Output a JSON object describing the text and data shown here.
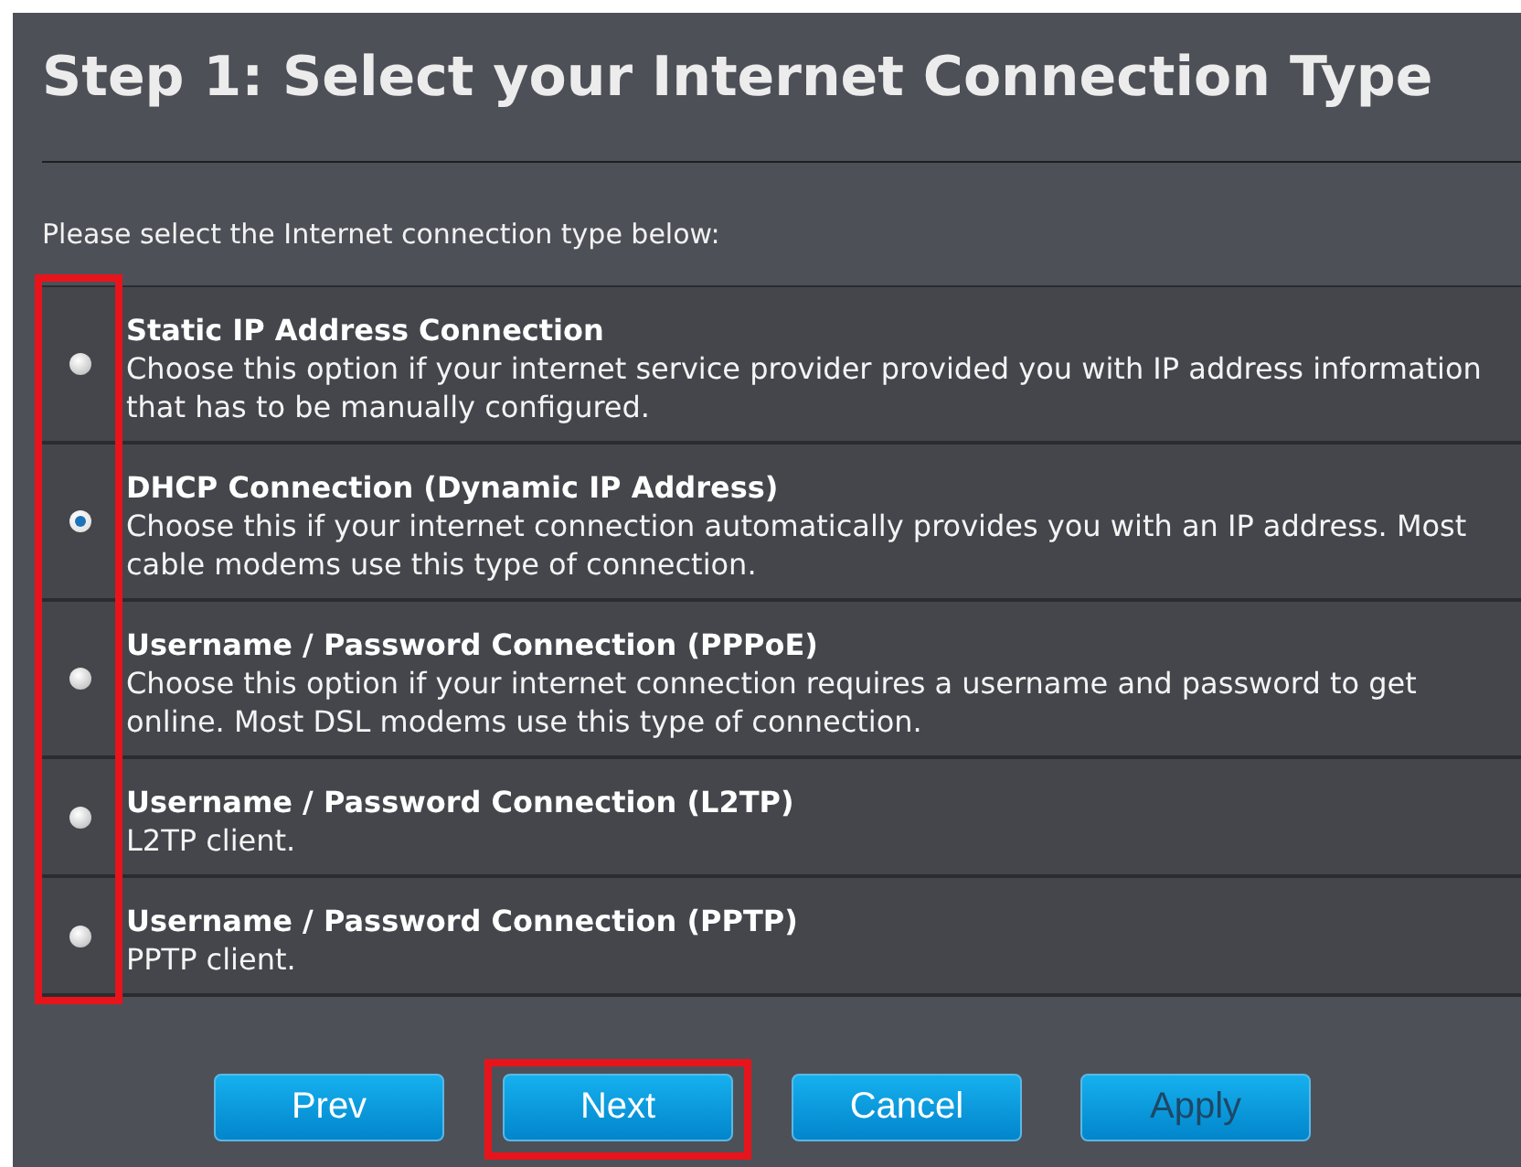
{
  "title": "Step 1: Select your Internet Connection Type",
  "prompt": "Please select the Internet connection type below:",
  "radio_column_highlighted": true,
  "options": [
    {
      "label": "Static IP Address Connection",
      "description": "Choose this option if your internet service provider provided you with IP address information that has to be manually configured.",
      "selected": false
    },
    {
      "label": "DHCP Connection (Dynamic IP Address)",
      "description": "Choose this if your internet connection automatically provides you with an IP address. Most cable modems use this type of connection.",
      "selected": true
    },
    {
      "label": "Username / Password Connection (PPPoE)",
      "description": "Choose this option if your internet connection requires a username and password to get online. Most DSL modems use this type of connection.",
      "selected": false
    },
    {
      "label": "Username / Password Connection (L2TP)",
      "description": "L2TP client.",
      "selected": false
    },
    {
      "label": "Username / Password Connection (PPTP)",
      "description": "PPTP client.",
      "selected": false
    }
  ],
  "buttons": [
    {
      "label": "Prev",
      "disabled": false,
      "highlighted": false
    },
    {
      "label": "Next",
      "disabled": false,
      "highlighted": true
    },
    {
      "label": "Cancel",
      "disabled": false,
      "highlighted": false
    },
    {
      "label": "Apply",
      "disabled": true,
      "highlighted": false
    }
  ]
}
